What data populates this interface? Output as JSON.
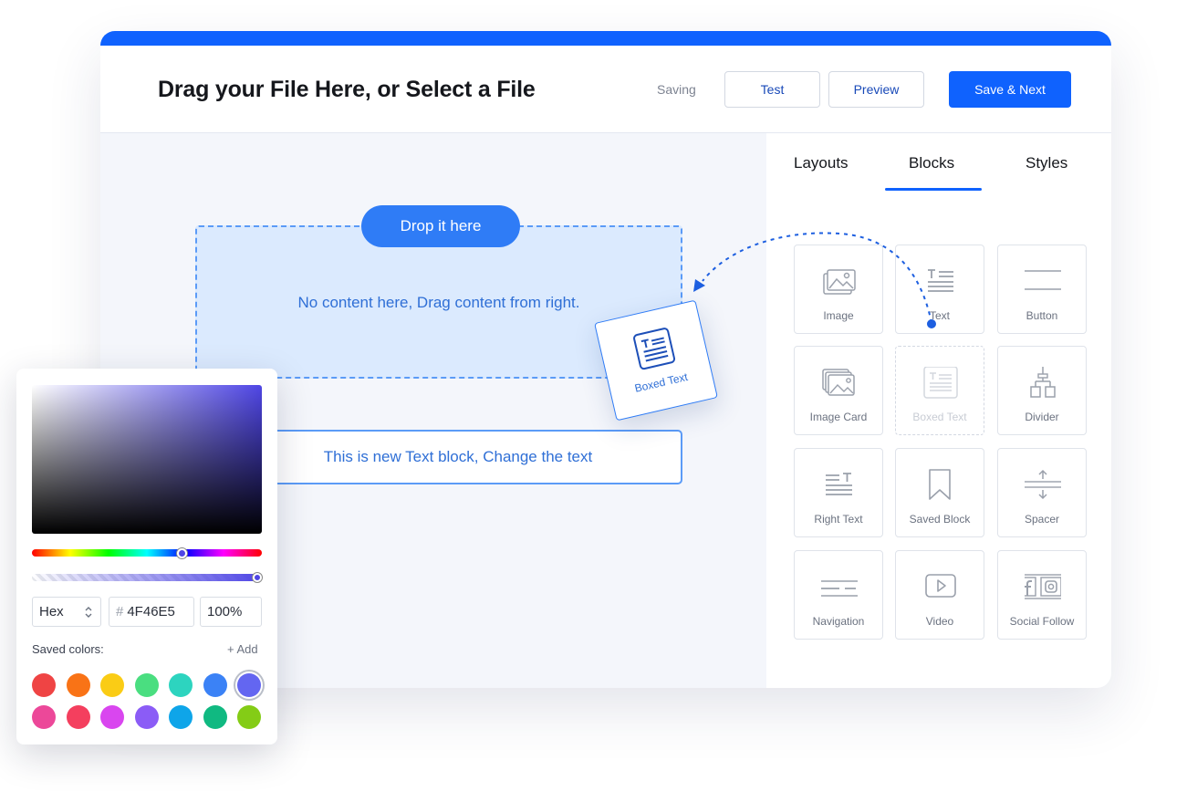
{
  "header": {
    "title": "Drag your File Here, or Select a File",
    "status": "Saving",
    "test_label": "Test",
    "preview_label": "Preview",
    "save_next_label": "Save & Next"
  },
  "canvas": {
    "drop_pill": "Drop it here",
    "drop_hint": "No content here, Drag content from right.",
    "text_block": "This is new Text block, Change the text",
    "dragged_card": {
      "label": "Boxed Text",
      "icon": "boxed-text-icon"
    }
  },
  "panel": {
    "tabs": [
      {
        "label": "Layouts",
        "active": false
      },
      {
        "label": "Blocks",
        "active": true
      },
      {
        "label": "Styles",
        "active": false
      }
    ],
    "blocks": [
      {
        "label": "Image",
        "icon": "image-icon"
      },
      {
        "label": "Text",
        "icon": "text-icon"
      },
      {
        "label": "Button",
        "icon": "button-icon"
      },
      {
        "label": "Image Card",
        "icon": "image-card-icon"
      },
      {
        "label": "Boxed Text",
        "icon": "boxed-text-icon",
        "state": "dragging"
      },
      {
        "label": "Divider",
        "icon": "divider-icon"
      },
      {
        "label": "Right Text",
        "icon": "right-text-icon"
      },
      {
        "label": "Saved Block",
        "icon": "bookmark-icon"
      },
      {
        "label": "Spacer",
        "icon": "spacer-icon"
      },
      {
        "label": "Navigation",
        "icon": "navigation-icon"
      },
      {
        "label": "Video",
        "icon": "video-icon"
      },
      {
        "label": "Social Follow",
        "icon": "social-follow-icon"
      }
    ]
  },
  "picker": {
    "mode": "Hex",
    "hash": "#",
    "hex": "4F46E5",
    "alpha": "100%",
    "saved_label": "Saved colors:",
    "add_label": "+ Add",
    "hue_position": 0.66,
    "alpha_value": 1.0,
    "swatches": [
      "#ef4444",
      "#f97316",
      "#facc15",
      "#4ade80",
      "#2dd4bf",
      "#3b82f6",
      "#6366f1",
      "#ec4899",
      "#f43f5e",
      "#d946ef",
      "#8b5cf6",
      "#0ea5e9",
      "#10b981",
      "#84cc16"
    ],
    "selected_swatch": 6
  },
  "colors": {
    "accent": "#0f62fe",
    "drop_zone_fill": "#dbeafe",
    "drop_border": "#5b9bf7",
    "text_blue": "#2f6fd6"
  }
}
